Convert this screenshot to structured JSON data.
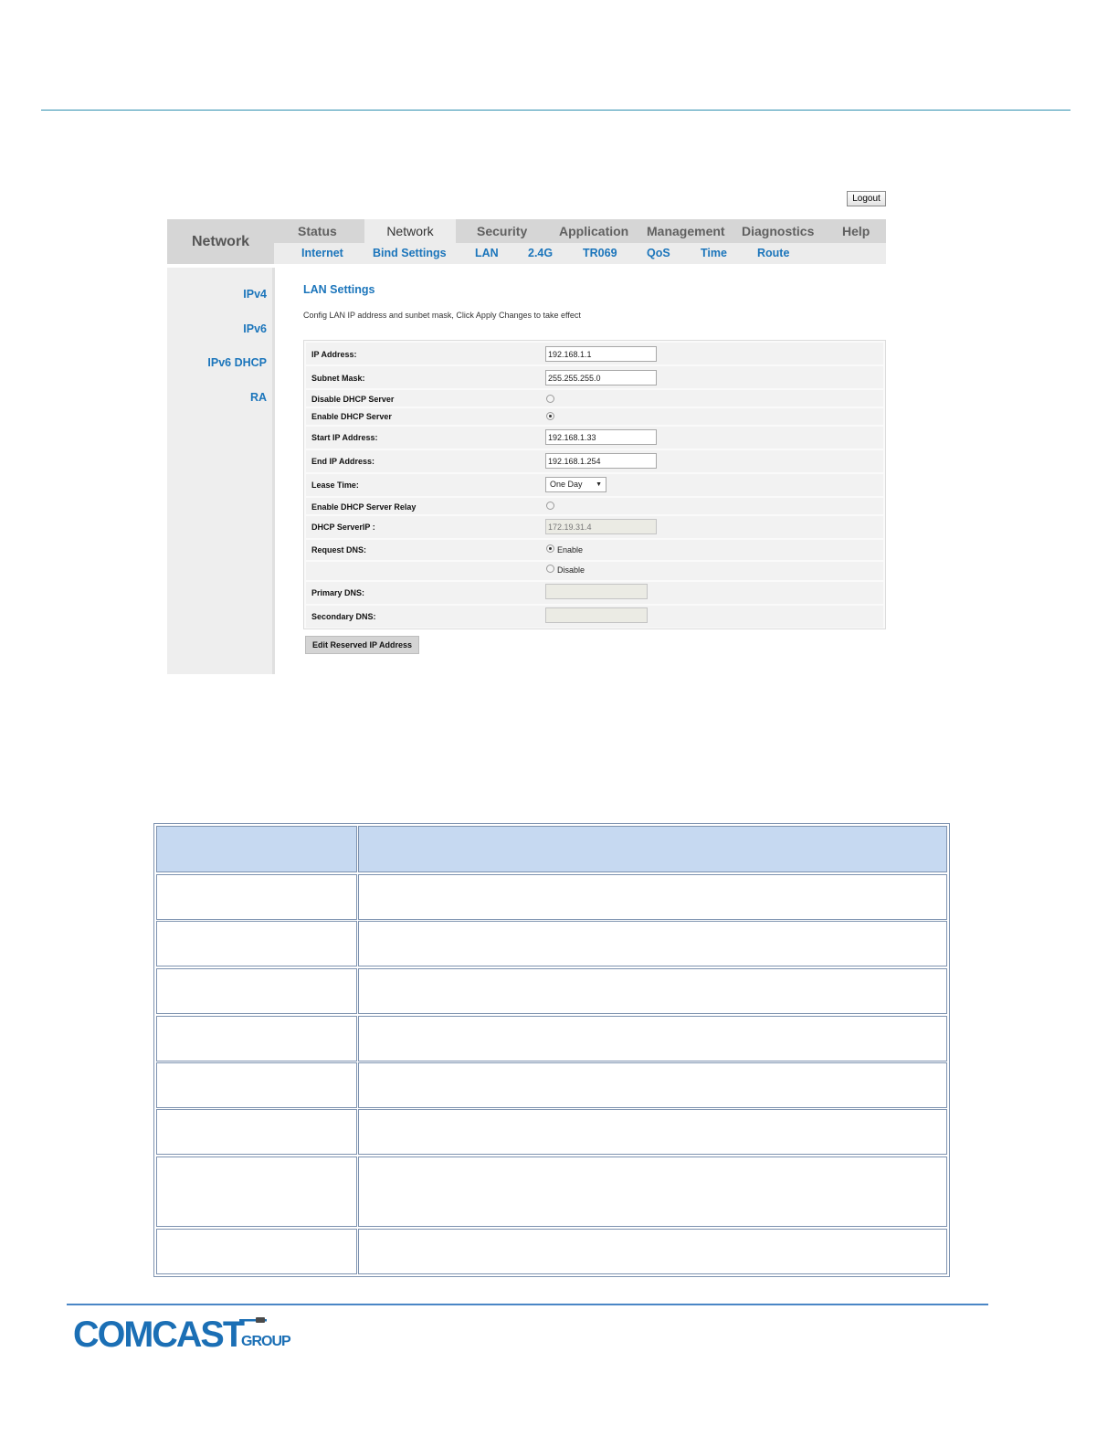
{
  "header": {
    "logout_label": "Logout",
    "section_title": "Network",
    "tabs": [
      "Status",
      "Network",
      "Security",
      "Application",
      "Management",
      "Diagnostics",
      "Help"
    ],
    "active_tab": "Network",
    "subtabs": [
      "Internet",
      "Bind Settings",
      "LAN",
      "2.4G",
      "TR069",
      "QoS",
      "Time",
      "Route"
    ]
  },
  "sidebar": {
    "items": [
      "IPv4",
      "IPv6",
      "IPv6 DHCP",
      "RA"
    ]
  },
  "content": {
    "title": "LAN Settings",
    "description": "Config LAN IP address and sunbet mask, Click Apply Changes to take effect",
    "fields": {
      "ip_address": {
        "label": "IP Address:",
        "value": "192.168.1.1"
      },
      "subnet_mask": {
        "label": "Subnet Mask:",
        "value": "255.255.255.0"
      },
      "disable_dhcp": {
        "label": "Disable DHCP Server",
        "checked": false
      },
      "enable_dhcp": {
        "label": "Enable DHCP Server",
        "checked": true
      },
      "start_ip": {
        "label": "Start IP Address:",
        "value": "192.168.1.33"
      },
      "end_ip": {
        "label": "End IP Address:",
        "value": "192.168.1.254"
      },
      "lease_time": {
        "label": "Lease Time:",
        "value": "One Day"
      },
      "dhcp_relay": {
        "label": "Enable DHCP Server Relay",
        "checked": false
      },
      "dhcp_server_ip": {
        "label": "DHCP ServerIP :",
        "value": "172.19.31.4"
      },
      "request_dns": {
        "label": "Request DNS:",
        "option_enable": "Enable",
        "option_disable": "Disable",
        "selected": "Enable"
      },
      "primary_dns": {
        "label": "Primary DNS:",
        "value": ""
      },
      "secondary_dns": {
        "label": "Secondary DNS:",
        "value": ""
      }
    },
    "edit_reserved_label": "Edit Reserved IP  Address"
  },
  "footer": {
    "logo_text_main": "COMCAST",
    "logo_text_group": "GROUP",
    "logo_color": "#1b6fb5"
  },
  "colors": {
    "link_blue": "#1b75bb",
    "header_gray": "#d6d6d6",
    "table_header": "#c6d9f1",
    "rule_teal": "#2f8fb0"
  }
}
